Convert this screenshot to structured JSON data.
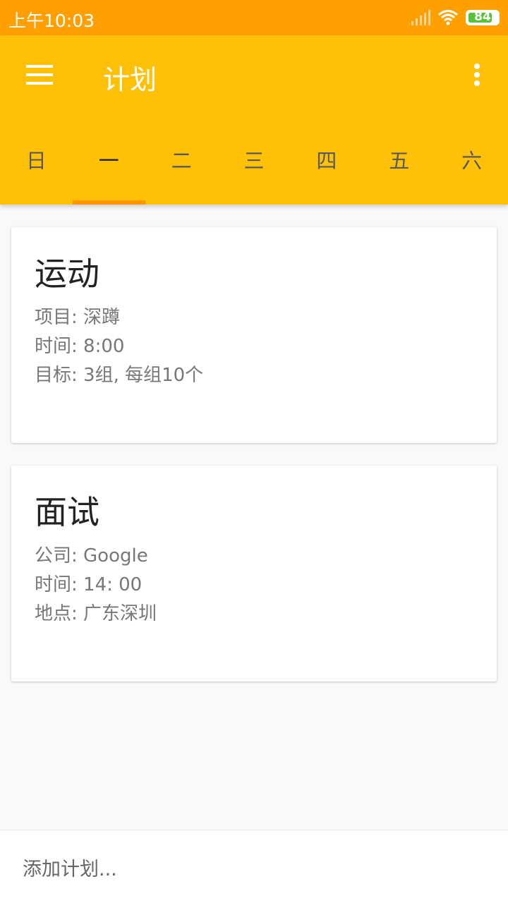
{
  "status_bar": {
    "time": "上午10:03",
    "battery": "84",
    "battery_level": 0.84
  },
  "app_bar": {
    "title": "计划",
    "menu_icon": "menu-icon",
    "overflow_icon": "more-vert-icon"
  },
  "tabs": [
    {
      "label": "日",
      "active": false
    },
    {
      "label": "一",
      "active": true
    },
    {
      "label": "二",
      "active": false
    },
    {
      "label": "三",
      "active": false
    },
    {
      "label": "四",
      "active": false
    },
    {
      "label": "五",
      "active": false
    },
    {
      "label": "六",
      "active": false
    }
  ],
  "cards": [
    {
      "title": "运动",
      "lines": [
        "项目: 深蹲",
        "时间: 8:00",
        "目标: 3组, 每组10个"
      ]
    },
    {
      "title": "面试",
      "lines": [
        "公司: Google",
        "时间: 14: 00",
        "地点: 广东深圳"
      ]
    }
  ],
  "add_plan": {
    "placeholder": "添加计划..."
  },
  "colors": {
    "status_bar": "#ff9f00",
    "app_bar": "#ffc107",
    "tab_indicator": "#ff9800",
    "battery": "#57c23a"
  }
}
